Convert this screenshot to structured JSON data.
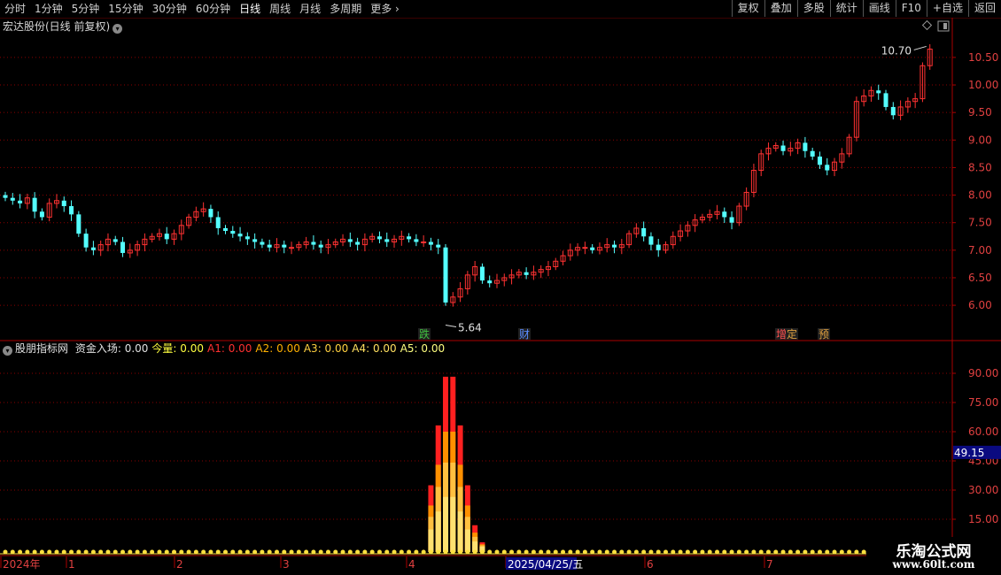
{
  "toolbar": {
    "periods": [
      "分时",
      "1分钟",
      "5分钟",
      "15分钟",
      "30分钟",
      "60分钟",
      "日线",
      "周线",
      "月线",
      "多周期",
      "更多"
    ],
    "active_index": 6,
    "buttons": [
      "复权",
      "叠加",
      "多股",
      "统计",
      "画线",
      "F10",
      "+自选",
      "返回"
    ]
  },
  "main_chart": {
    "title": "宏达股份(日线 前复权)",
    "y_ticks": [
      "10.50",
      "10.00",
      "9.50",
      "9.00",
      "8.50",
      "8.00",
      "7.50",
      "7.00",
      "6.50",
      "6.00"
    ],
    "high_label": "10.70",
    "low_label": "5.64",
    "markers": [
      {
        "text": "跌",
        "color": "#40c040"
      },
      {
        "text": "财",
        "color": "#5a8cff"
      },
      {
        "text": "增",
        "color": "#ff5050"
      },
      {
        "text": "定",
        "color": "#e0a040"
      },
      {
        "text": "预",
        "color": "#e0a040"
      }
    ]
  },
  "indicator": {
    "name": "股朋指标网",
    "fields": [
      {
        "label": "资金入场:",
        "value": "0.00",
        "color": "#e0e0e0"
      },
      {
        "label": "今量:",
        "value": "0.00",
        "color": "#ffff40"
      },
      {
        "label": "A1:",
        "value": "0.00",
        "color": "#ff3030"
      },
      {
        "label": "A2:",
        "value": "0.00",
        "color": "#ffb000"
      },
      {
        "label": "A3:",
        "value": "0.00",
        "color": "#ffd040"
      },
      {
        "label": "A4:",
        "value": "0.00",
        "color": "#ffe060"
      },
      {
        "label": "A5:",
        "value": "0.00",
        "color": "#ffff80"
      }
    ],
    "y_ticks": [
      "90.00",
      "75.00",
      "60.00",
      "45.00",
      "30.00",
      "15.00"
    ],
    "current_label": "49.15"
  },
  "x_axis": {
    "labels": [
      "2024年",
      "1",
      "2",
      "3",
      "4",
      "2025/04/25/五",
      "6",
      "7"
    ]
  },
  "watermark": {
    "line1": "乐淘公式网",
    "line2": "www.60lt.com"
  },
  "colors": {
    "up": "#ff3232",
    "down": "#54ffff",
    "grid": "#8a0000",
    "axis_text": "#e04040"
  },
  "chart_data": {
    "type": "candlestick",
    "ylim": [
      5.6,
      10.9
    ],
    "high": 10.7,
    "low": 5.64,
    "close_series": [
      7.95,
      7.9,
      7.85,
      7.95,
      7.7,
      7.6,
      7.85,
      7.9,
      7.8,
      7.65,
      7.3,
      7.05,
      7.0,
      7.1,
      7.2,
      7.15,
      6.95,
      7.0,
      7.1,
      7.2,
      7.25,
      7.3,
      7.2,
      7.3,
      7.45,
      7.6,
      7.7,
      7.75,
      7.6,
      7.4,
      7.35,
      7.3,
      7.25,
      7.2,
      7.15,
      7.1,
      7.05,
      7.1,
      7.05,
      7.05,
      7.1,
      7.15,
      7.1,
      7.05,
      7.1,
      7.15,
      7.2,
      7.15,
      7.1,
      7.2,
      7.25,
      7.2,
      7.15,
      7.2,
      7.25,
      7.2,
      7.15,
      7.15,
      7.1,
      7.05,
      6.05,
      6.15,
      6.3,
      6.55,
      6.7,
      6.45,
      6.4,
      6.45,
      6.5,
      6.55,
      6.6,
      6.55,
      6.6,
      6.65,
      6.7,
      6.8,
      6.9,
      7.0,
      7.05,
      7.05,
      7.0,
      7.05,
      7.1,
      7.05,
      7.1,
      7.3,
      7.4,
      7.25,
      7.1,
      7.0,
      7.1,
      7.25,
      7.35,
      7.45,
      7.55,
      7.6,
      7.65,
      7.7,
      7.6,
      7.5,
      7.8,
      8.05,
      8.45,
      8.75,
      8.85,
      8.9,
      8.8,
      8.85,
      8.95,
      8.8,
      8.7,
      8.55,
      8.45,
      8.6,
      8.75,
      9.05,
      9.7,
      9.8,
      9.9,
      9.85,
      9.6,
      9.45,
      9.6,
      9.7,
      9.75,
      10.35,
      10.65
    ],
    "indicator_peak": 92,
    "indicator_ylim": [
      0,
      100
    ]
  }
}
